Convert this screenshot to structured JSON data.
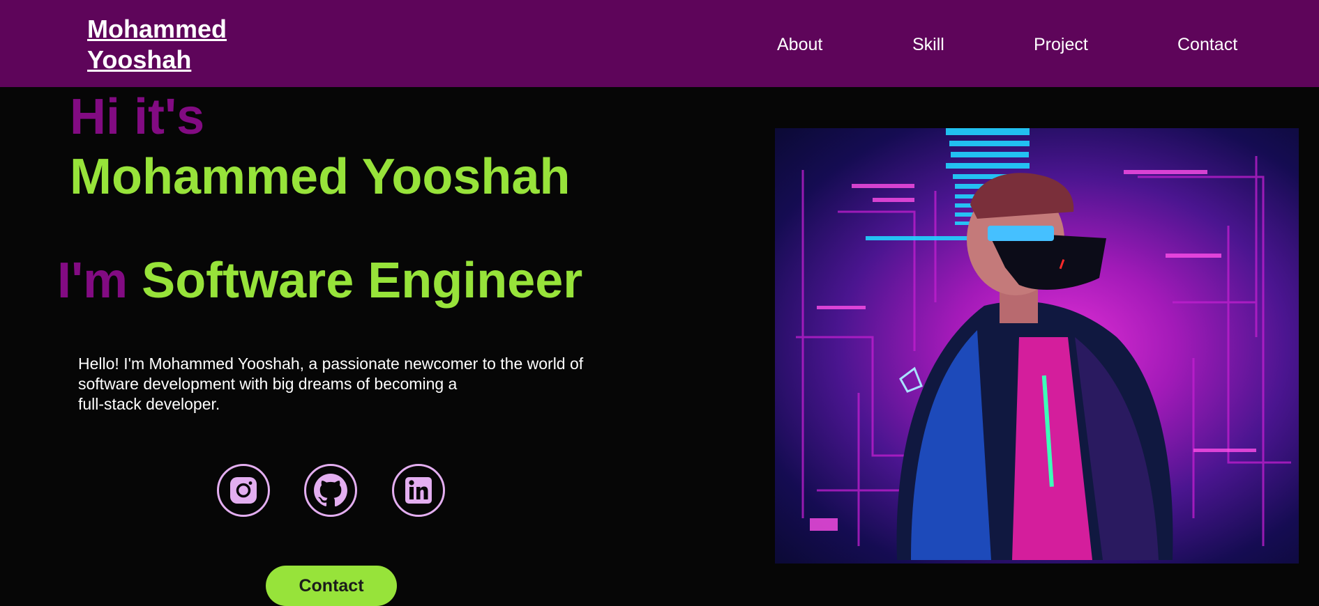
{
  "navbar": {
    "brand_line1": "Mohammed",
    "brand_line2": "Yooshah",
    "links": [
      {
        "label": "About"
      },
      {
        "label": "Skill"
      },
      {
        "label": "Project"
      },
      {
        "label": "Contact"
      }
    ]
  },
  "hero": {
    "greeting": "Hi it's",
    "name": "Mohammed Yooshah",
    "role_prefix": "I'm",
    "role": "Software Engineer",
    "bio_lines": [
      "Hello! I'm Mohammed Yooshah, a passionate newcomer to the world of",
      "software development with big dreams of becoming a",
      "full-stack developer."
    ],
    "contact_button": "Contact"
  },
  "social": [
    {
      "icon": "instagram-icon"
    },
    {
      "icon": "github-icon"
    },
    {
      "icon": "linkedin-icon"
    }
  ],
  "colors": {
    "navbar_bg": "#5e055a",
    "accent_purple": "#820b82",
    "accent_green": "#97e33a",
    "icon_ring": "#e3aef0",
    "page_bg": "#060606"
  }
}
